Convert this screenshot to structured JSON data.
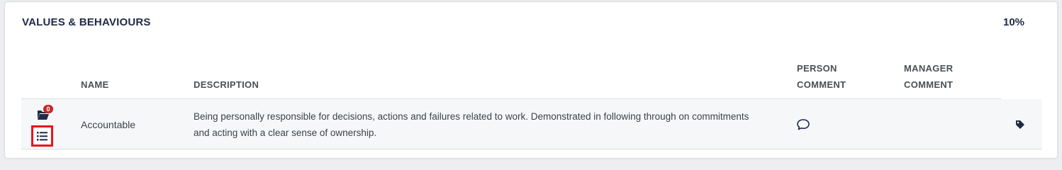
{
  "section": {
    "title": "VALUES & BEHAVIOURS",
    "weight": "10%"
  },
  "columns": {
    "name": "NAME",
    "description": "DESCRIPTION",
    "person_comment_line1": "PERSON",
    "person_comment_line2": "COMMENT",
    "manager_comment_line1": "MANAGER",
    "manager_comment_line2": "COMMENT"
  },
  "rows": [
    {
      "attachment_count": "0",
      "name": "Accountable",
      "description": "Being personally responsible for decisions, actions and failures related to work. Demonstrated in following through on commitments and acting with a clear sense of ownership."
    }
  ],
  "icons": {
    "folder": "folder-open-icon",
    "list": "list-icon",
    "comment": "comment-icon",
    "tag": "tag-icon"
  },
  "colors": {
    "title": "#1f2a44",
    "badge": "#c62828",
    "highlight_border": "#e8141c"
  }
}
